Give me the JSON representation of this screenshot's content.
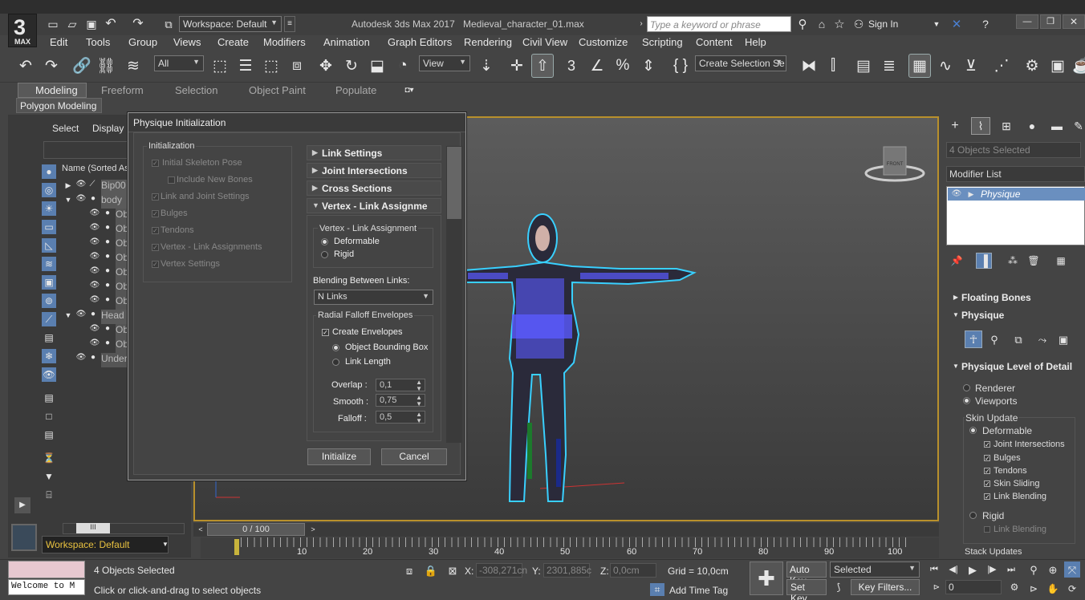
{
  "app": {
    "title": "Autodesk 3ds Max 2017",
    "filename": "Medieval_character_01.max",
    "logo_number": "3",
    "logo_text": "MAX"
  },
  "titlebar": {
    "workspace_label": "Workspace: Default",
    "search_placeholder": "Type a keyword or phrase",
    "sign_in": "Sign In"
  },
  "menu": [
    "Edit",
    "Tools",
    "Group",
    "Views",
    "Create",
    "Modifiers",
    "Animation",
    "Graph Editors",
    "Rendering",
    "Civil View",
    "Customize",
    "Scripting",
    "Content",
    "Help"
  ],
  "toolbar": {
    "filter_value": "All",
    "refcoord_value": "View",
    "selection_set_value": "Create Selection Se",
    "snap_number": "3"
  },
  "ribbon": {
    "tabs": [
      "Modeling",
      "Freeform",
      "Selection",
      "Object Paint",
      "Populate"
    ],
    "subpanel": "Polygon Modeling"
  },
  "scene_explorer": {
    "tabs": [
      "Select",
      "Display"
    ],
    "column_header": "Name (Sorted As",
    "rows": [
      {
        "label": "Bip00"
      },
      {
        "label": "body"
      },
      {
        "label": "Ob"
      },
      {
        "label": "Ob"
      },
      {
        "label": "Ob"
      },
      {
        "label": "Ob"
      },
      {
        "label": "Ob"
      },
      {
        "label": "Ob"
      },
      {
        "label": "Ob"
      },
      {
        "label": "Head"
      },
      {
        "label": "Ob"
      },
      {
        "label": "Ob"
      },
      {
        "label": "Under"
      }
    ],
    "scrollbar_grip": "III",
    "workspace": "Workspace: Default"
  },
  "dialog": {
    "title": "Physique Initialization",
    "init_group": "Initialization",
    "init_options": [
      {
        "label": "Initial Skeleton Pose",
        "checked": true
      },
      {
        "label": "Include New Bones",
        "checked": false
      },
      {
        "label": "Link and Joint Settings",
        "checked": true
      },
      {
        "label": "Bulges",
        "checked": true
      },
      {
        "label": "Tendons",
        "checked": true
      },
      {
        "label": "Vertex - Link Assignments",
        "checked": true
      },
      {
        "label": "Vertex Settings",
        "checked": true
      }
    ],
    "rollouts": [
      "Link Settings",
      "Joint Intersections",
      "Cross Sections",
      "Vertex - Link Assignme"
    ],
    "vla_group": "Vertex - Link Assignment",
    "deformable": "Deformable",
    "rigid": "Rigid",
    "blending_label": "Blending Between Links:",
    "blending_value": "N Links",
    "radial_group": "Radial Falloff Envelopes",
    "create_envelopes": "Create Envelopes",
    "object_bbox": "Object Bounding Box",
    "link_length": "Link Length",
    "overlap_label": "Overlap :",
    "overlap_value": "0,1",
    "smooth_label": "Smooth :",
    "smooth_value": "0,75",
    "falloff_label": "Falloff :",
    "falloff_value": "0,5",
    "initialize_button": "Initialize",
    "cancel_button": "Cancel"
  },
  "viewport": {
    "gizmo_label": "FRONT",
    "accent": "#b8902c",
    "outline_color": "#39d0ff",
    "vertex_color": "#5a5aff"
  },
  "command_panel": {
    "selection": "4 Objects Selected",
    "modifier_list": "Modifier List",
    "stack_item": "Physique",
    "floating_bones": "Floating Bones",
    "physique": "Physique",
    "level_of_detail": "Physique Level of Detail",
    "renderer": "Renderer",
    "viewports": "Viewports",
    "skin_update": "Skin Update",
    "deformable": "Deformable",
    "skin_checks": [
      "Joint Intersections",
      "Bulges",
      "Tendons",
      "Skin Sliding",
      "Link Blending"
    ],
    "rigid": "Rigid",
    "rigid_link_blending": "Link Blending",
    "stack_updates": "Stack Updates"
  },
  "timeline": {
    "frame_counter": "0 / 100",
    "ticks": [
      "10",
      "20",
      "30",
      "40",
      "50",
      "60",
      "70",
      "80",
      "90",
      "100"
    ]
  },
  "status": {
    "maxscript": "Welcome to M",
    "selected": "4 Objects Selected",
    "prompt": "Click or click-and-drag to select objects",
    "x_label": "X:",
    "x_value": "-308,271cn",
    "y_label": "Y:",
    "y_value": "2301,885c",
    "z_label": "Z:",
    "z_value": "0,0cm",
    "grid": "Grid = 10,0cm",
    "add_time_tag": "Add Time Tag",
    "auto_key": "Auto Key",
    "set_key": "Set Key",
    "key_mode": "Selected",
    "key_filters": "Key Filters...",
    "frame": "0"
  }
}
